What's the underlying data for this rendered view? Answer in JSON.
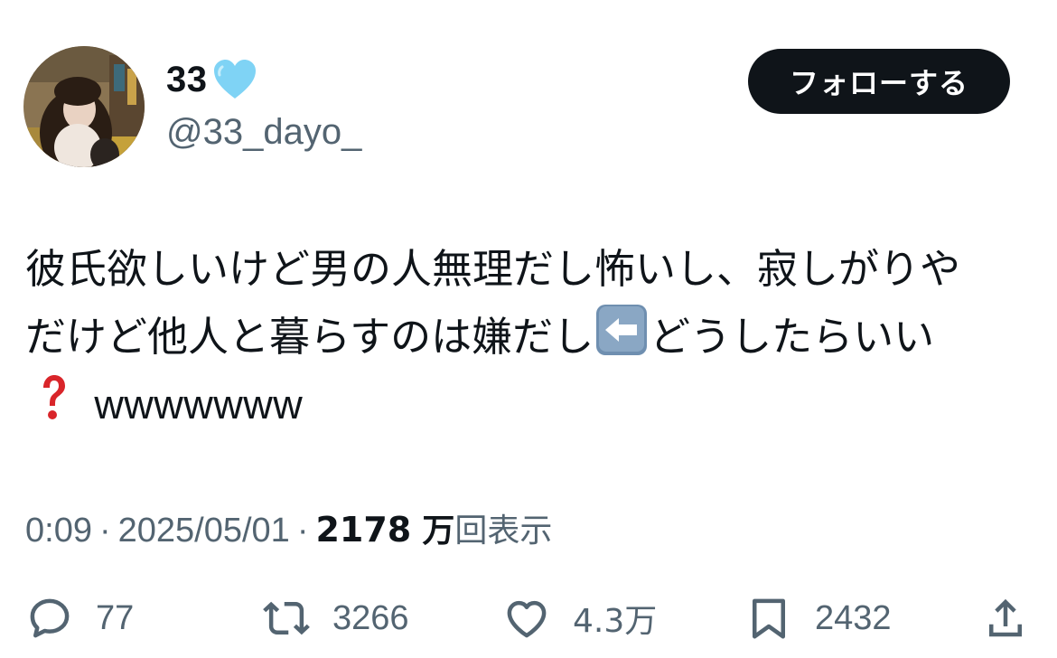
{
  "user": {
    "display_name": "33",
    "name_emoji": "light-blue-heart-icon",
    "handle": "@33_dayo_",
    "avatar": "user-avatar-photo"
  },
  "follow_button": {
    "label": "フォローする"
  },
  "tweet": {
    "line1": "彼氏欲しいけど男の人無理だし怖いし、寂しがりや",
    "line2_part1": "だけど他人と暮らすのは嫌だし",
    "line2_emoji": "left-arrow-icon",
    "line2_part2": "どうしたらいい",
    "line3_emoji": "question-mark-icon",
    "line3_text": "wwwwwww"
  },
  "meta": {
    "time": "0:09",
    "separator": "·",
    "date": "2025/05/01",
    "views_count": "2178",
    "views_unit": "万",
    "views_label": "回表示"
  },
  "actions": {
    "reply": {
      "icon": "reply-icon",
      "count": "77"
    },
    "retweet": {
      "icon": "retweet-icon",
      "count": "3266"
    },
    "like": {
      "icon": "heart-icon",
      "count": "4.3万"
    },
    "bookmark": {
      "icon": "bookmark-icon",
      "count": "2432"
    },
    "share": {
      "icon": "share-icon"
    }
  },
  "colors": {
    "text_primary": "#0f1419",
    "text_secondary": "#536471",
    "follow_bg": "#0f1419",
    "heart_emoji": "#7fd3f5",
    "question_mark": "#d9252a",
    "arrow_key_bg": "#7b97b3"
  }
}
